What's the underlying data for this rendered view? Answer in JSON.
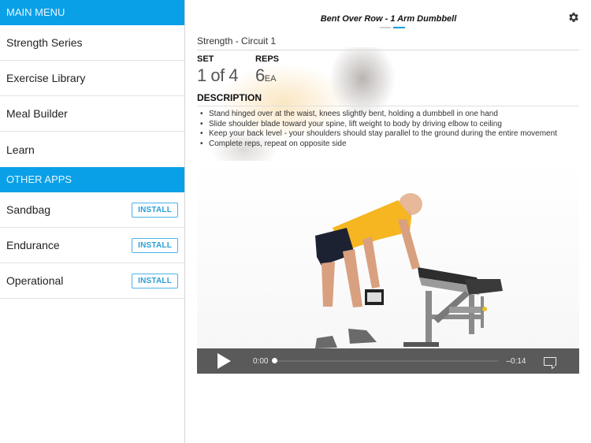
{
  "sidebar": {
    "main_menu_header": "MAIN MENU",
    "main_menu": [
      {
        "label": "Strength Series"
      },
      {
        "label": "Exercise Library"
      },
      {
        "label": "Meal Builder"
      },
      {
        "label": "Learn"
      }
    ],
    "other_apps_header": "OTHER APPS",
    "other_apps": [
      {
        "label": "Sandbag",
        "button": "INSTALL"
      },
      {
        "label": "Endurance",
        "button": "INSTALL"
      },
      {
        "label": "Operational",
        "button": "INSTALL"
      }
    ]
  },
  "header": {
    "title": "Bent Over Row - 1 Arm Dumbbell",
    "page_count": 2,
    "active_page": 2,
    "settings_icon": "gear-icon"
  },
  "workout": {
    "circuit": "Strength - Circuit 1",
    "set_label": "SET",
    "set_value": "1 of 4",
    "reps_label": "REPS",
    "reps_value": "6",
    "reps_unit": "EA",
    "description_label": "DESCRIPTION",
    "description": [
      "Stand hinged over at the waist, knees slightly bent, holding a dumbbell in one hand",
      "Slide shoulder blade toward your spine, lift weight to body by driving elbow to ceiling",
      "Keep your back level - your shoulders should stay parallel to the ground during the entire movement",
      "Complete reps, repeat on opposite side"
    ]
  },
  "video": {
    "current_time": "0:00",
    "remaining_time": "–0:14",
    "progress": 0,
    "play_icon": "play-icon",
    "captions_icon": "captions-icon"
  },
  "colors": {
    "accent": "#0aa0e8",
    "install_border": "#4ab3e6",
    "controls_bg": "#5a5a5a"
  }
}
